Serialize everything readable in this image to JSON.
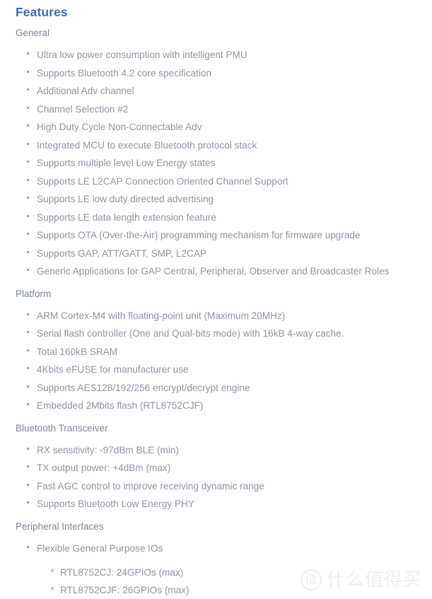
{
  "document": {
    "title": "Features",
    "title_color": "#3c6db5",
    "heading_color": "#7e8795",
    "body_color": "#8d95a2",
    "background_color": "#ffffff"
  },
  "sections": [
    {
      "heading": "General",
      "items": [
        "Ultra low power consumption with intelligent PMU",
        "Supports Bluetooth 4.2 core specification",
        "Additional Adv channel",
        "Channel Selection #2",
        "High Duty Cycle Non-Connectable Adv",
        "Integrated MCU to execute Bluetooth protocol stack",
        "Supports multiple level Low Energy states",
        "Supports LE L2CAP Connection Oriented Channel Support",
        "Supports LE low duty directed advertising",
        "Supports LE data length extension feature",
        "Supports OTA (Over-the-Air) programming mechanism for firmware upgrade",
        "Supports GAP, ATT/GATT, SMP, L2CAP",
        "Generic Applications for GAP Central, Peripheral, Observer and Broadcaster Roles"
      ]
    },
    {
      "heading": "Platform",
      "items": [
        "ARM Cortex-M4 with floating-point unit (Maximum 20MHz)",
        "Serial flash controller (One and Qual-bits mode) with 16kB 4-way cache.",
        "Total 160kB SRAM",
        "4Kbits eFUSE for manufacturer use",
        "Supports AES128/192/256 encrypt/decrypt engine",
        "Embedded 2Mbits flash (RTL8752CJF)"
      ]
    },
    {
      "heading": "Bluetooth Transceiver",
      "items": [
        "RX sensitivity: -97dBm BLE (min)",
        "TX output power: +4dBm (max)",
        "Fast AGC control to improve receiving dynamic range",
        "Supports Bluetooth Low Energy PHY"
      ]
    },
    {
      "heading": "Peripheral Interfaces",
      "items": [
        "Flexible General Purpose IOs"
      ],
      "subitems": [
        "RTL8752CJ: 24GPIOs (max)",
        "RTL8752CJF: 26GPIOs (max)"
      ]
    }
  ],
  "watermark": {
    "badge": "值",
    "text": "什么值得买"
  }
}
